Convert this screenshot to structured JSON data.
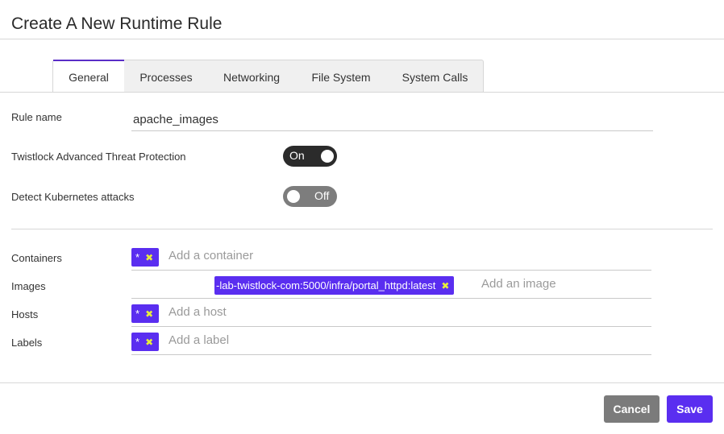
{
  "dialog": {
    "title": "Create A New Runtime Rule"
  },
  "tabs": [
    {
      "label": "General",
      "active": true
    },
    {
      "label": "Processes",
      "active": false
    },
    {
      "label": "Networking",
      "active": false
    },
    {
      "label": "File System",
      "active": false
    },
    {
      "label": "System Calls",
      "active": false
    }
  ],
  "rule_name": {
    "label": "Rule name",
    "value": "apache_images"
  },
  "toggles": {
    "atp": {
      "label": "Twistlock Advanced Threat Protection",
      "state": "On"
    },
    "k8s": {
      "label": "Detect Kubernetes attacks",
      "state": "Off"
    }
  },
  "scope": {
    "containers": {
      "label": "Containers",
      "chip": "*",
      "placeholder": "Add a container"
    },
    "images": {
      "label": "Images",
      "chip": "-lab-twistlock-com:5000/infra/portal_httpd:latest",
      "placeholder": "Add an image"
    },
    "hosts": {
      "label": "Hosts",
      "chip": "*",
      "placeholder": "Add a host"
    },
    "labels": {
      "label": "Labels",
      "chip": "*",
      "placeholder": "Add a label"
    }
  },
  "chip_remove_symbol": "✖",
  "buttons": {
    "cancel": "Cancel",
    "save": "Save"
  },
  "colors": {
    "accent": "#5a2ef0",
    "chip_remove": "#e8ef3a",
    "toggle_on": "#2b2b2b",
    "toggle_off": "#7d7d7d",
    "cancel_button": "#7b7b7b"
  }
}
